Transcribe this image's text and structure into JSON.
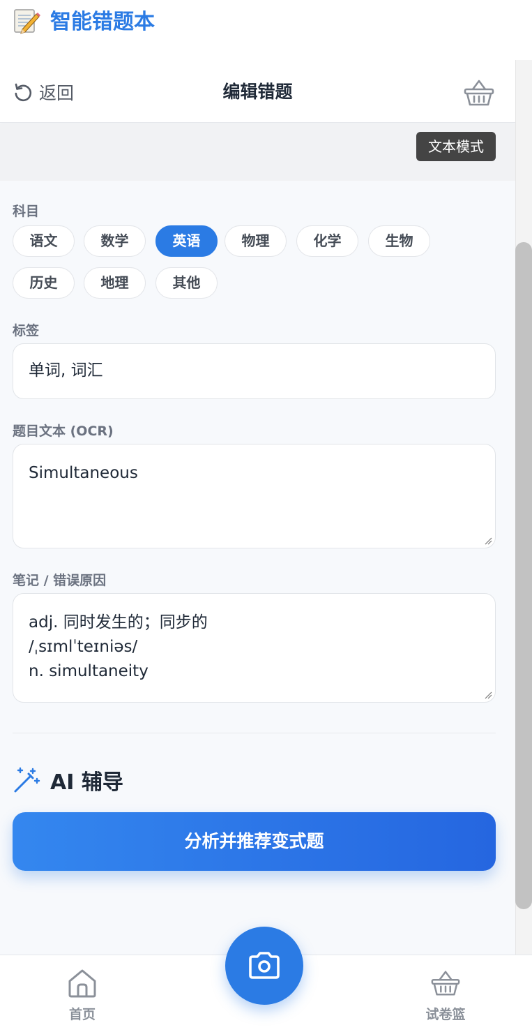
{
  "app": {
    "title": "智能错题本"
  },
  "nav": {
    "back_label": "返回",
    "title": "编辑错题"
  },
  "mode_button": "文本模式",
  "subject": {
    "label": "科目",
    "options": [
      "语文",
      "数学",
      "英语",
      "物理",
      "化学",
      "生物",
      "历史",
      "地理",
      "其他"
    ],
    "selected": "英语"
  },
  "tags": {
    "label": "标签",
    "value": "单词, 词汇"
  },
  "question_text": {
    "label": "题目文本 (OCR)",
    "value": "Simultaneous"
  },
  "notes": {
    "label": "笔记 / 错误原因",
    "lines": [
      "adj. 同时发生的；同步的",
      "/ˌsɪmlˈteɪniəs/",
      "n. simultaneity"
    ]
  },
  "ai": {
    "heading": "AI 辅导",
    "action_label": "分析并推荐变式题"
  },
  "tab_bar": {
    "home_label": "首页",
    "basket_label": "试卷篮"
  },
  "colors": {
    "accent": "#2b7be4",
    "chip_border": "#e3e5e9",
    "mode_button_bg": "#444444"
  }
}
